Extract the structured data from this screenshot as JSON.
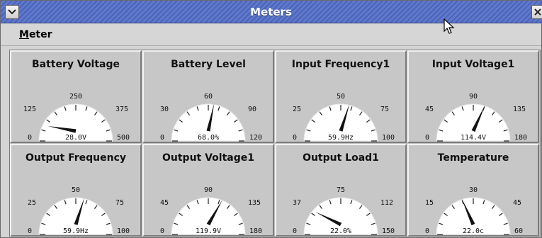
{
  "window": {
    "title": "Meters",
    "accent": "#5570c4"
  },
  "menubar": {
    "items": [
      {
        "label": "Meter",
        "mnemonic": "M"
      }
    ]
  },
  "meters": [
    {
      "title": "Battery Voltage",
      "min": "0",
      "mid_low": "125",
      "top": "250",
      "mid_high": "375",
      "max": "500",
      "readout": "28.0V",
      "value": 28.0,
      "range": [
        0,
        500
      ]
    },
    {
      "title": "Battery Level",
      "min": "0",
      "mid_low": "30",
      "top": "60",
      "mid_high": "90",
      "max": "120",
      "readout": "68.0%",
      "value": 68.0,
      "range": [
        0,
        120
      ]
    },
    {
      "title": "Input Frequency1",
      "min": "0",
      "mid_low": "25",
      "top": "50",
      "mid_high": "75",
      "max": "100",
      "readout": "59.9Hz",
      "value": 59.9,
      "range": [
        0,
        100
      ]
    },
    {
      "title": "Input Voltage1",
      "min": "0",
      "mid_low": "45",
      "top": "90",
      "mid_high": "135",
      "max": "180",
      "readout": "114.4V",
      "value": 114.4,
      "range": [
        0,
        180
      ]
    },
    {
      "title": "Output Frequency",
      "min": "0",
      "mid_low": "25",
      "top": "50",
      "mid_high": "75",
      "max": "100",
      "readout": "59.9Hz",
      "value": 59.9,
      "range": [
        0,
        100
      ]
    },
    {
      "title": "Output Voltage1",
      "min": "0",
      "mid_low": "45",
      "top": "90",
      "mid_high": "135",
      "max": "180",
      "readout": "119.9V",
      "value": 119.9,
      "range": [
        0,
        180
      ]
    },
    {
      "title": "Output Load1",
      "min": "0",
      "mid_low": "37",
      "top": "75",
      "mid_high": "112",
      "max": "150",
      "readout": "22.0%",
      "value": 22.0,
      "range": [
        0,
        150
      ]
    },
    {
      "title": "Temperature",
      "min": "0",
      "mid_low": "15",
      "top": "30",
      "mid_high": "45",
      "max": "60",
      "readout": "22.0c",
      "value": 22.0,
      "range": [
        0,
        60
      ]
    }
  ]
}
